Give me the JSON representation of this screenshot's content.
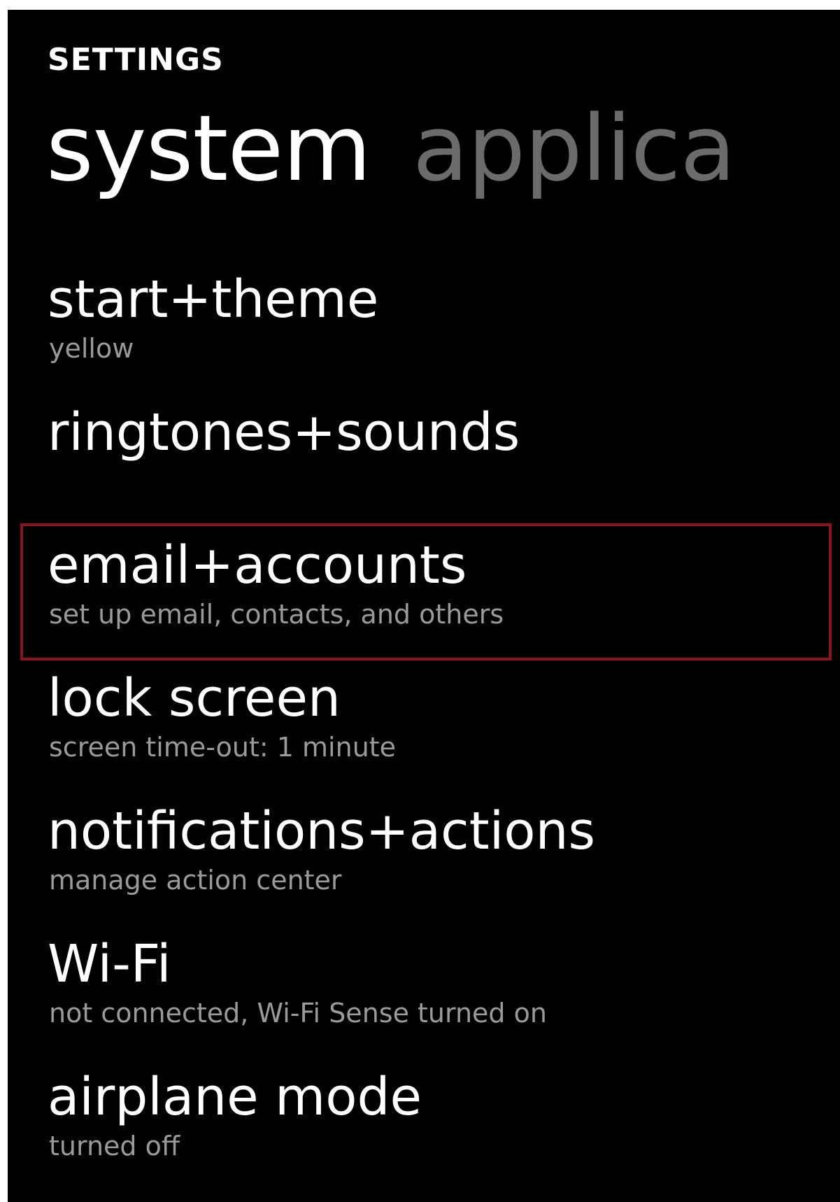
{
  "header": {
    "title": "SETTINGS"
  },
  "pivot": {
    "tabs": [
      {
        "label": "system"
      },
      {
        "label": "applica"
      }
    ]
  },
  "settings": {
    "items": [
      {
        "label": "start+theme",
        "subtitle": "yellow"
      },
      {
        "label": "ringtones+sounds",
        "subtitle": ""
      },
      {
        "label": "email+accounts",
        "subtitle": "set up email, contacts, and others"
      },
      {
        "label": "lock screen",
        "subtitle": "screen time-out: 1 minute"
      },
      {
        "label": "notifications+actions",
        "subtitle": "manage action center"
      },
      {
        "label": "Wi-Fi",
        "subtitle": "not connected, Wi-Fi Sense turned on"
      },
      {
        "label": "airplane mode",
        "subtitle": "turned off"
      }
    ]
  },
  "colors": {
    "background": "#000000",
    "primary_text": "#ffffff",
    "secondary_text": "#9a9a9a",
    "inactive_tab": "#6b6b6b",
    "highlight_border": "#8b1422"
  }
}
